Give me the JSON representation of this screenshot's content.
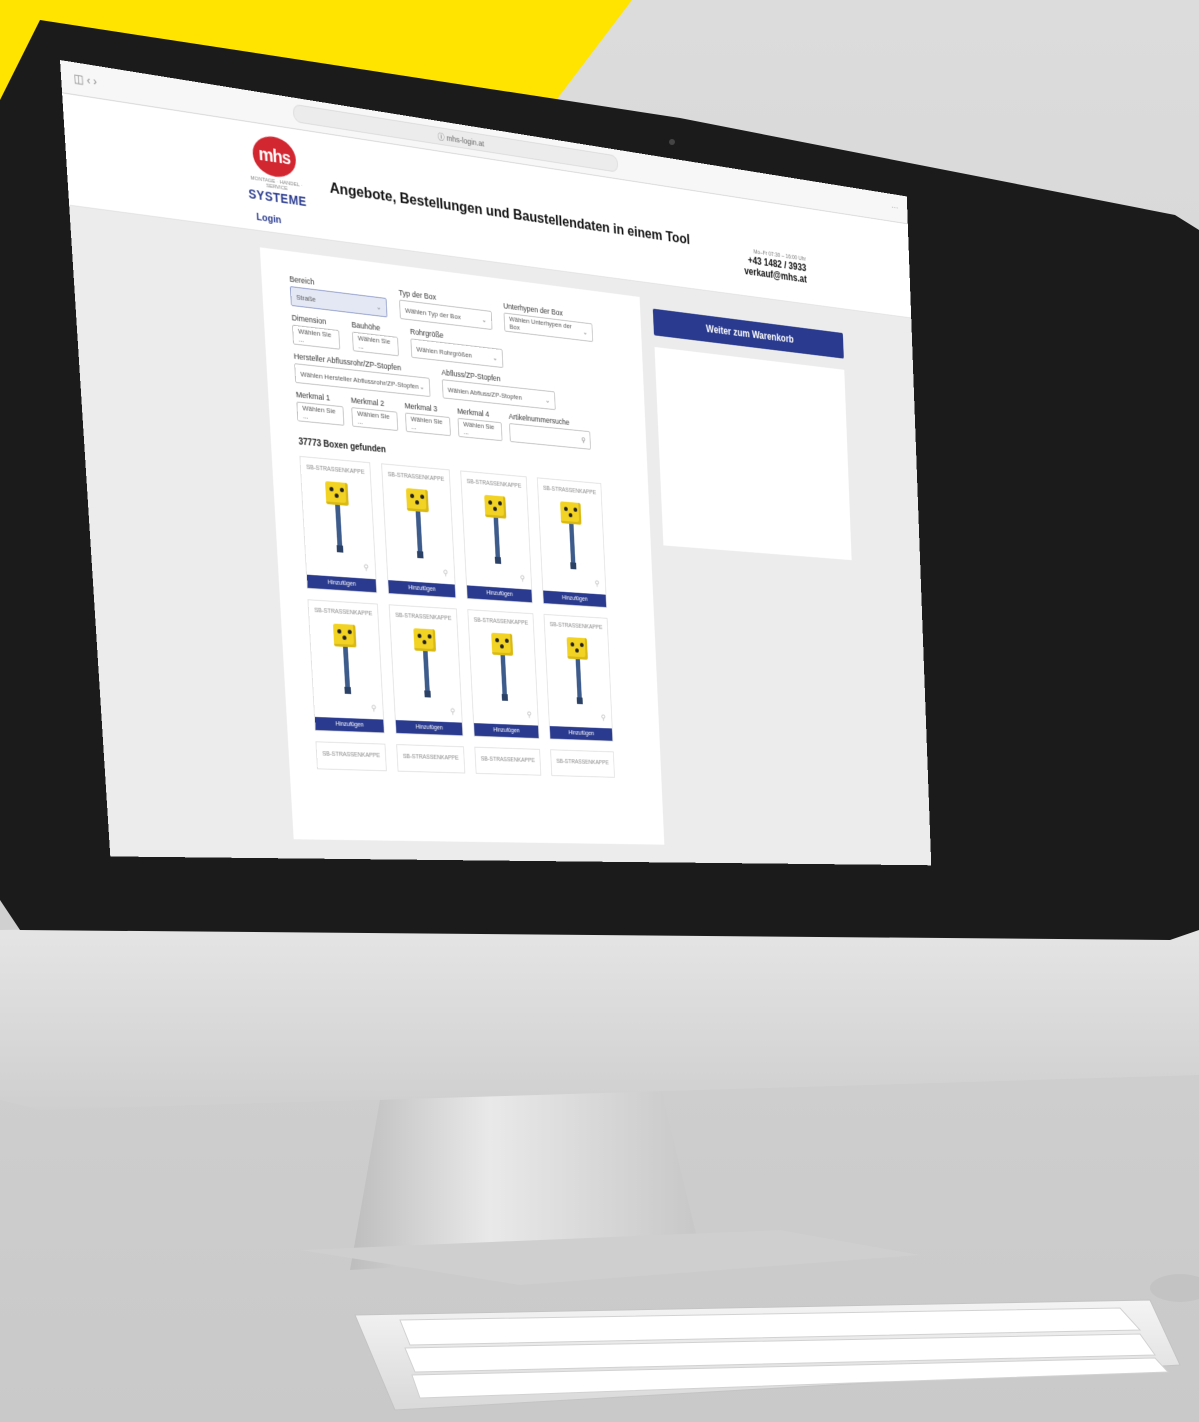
{
  "browser": {
    "url": "ⓘ mhs-login.at"
  },
  "header": {
    "logo": {
      "initials": "mhs",
      "initials_last": "s",
      "subtitle": "MONTAGE · HANDEL · SERVICE",
      "brand": "SYSTEME"
    },
    "tagline": "Angebote, Bestellungen und Baustellendaten in einem Tool",
    "login_label": "Login",
    "contact": {
      "hours_label": "Mo–Fr 07:30 – 16:00 Uhr",
      "phone": "+43 1482 / 3933",
      "email": "verkauf@mhs.at"
    }
  },
  "filters": {
    "row1": [
      {
        "label": "Bereich",
        "value": "Straße",
        "active": true
      },
      {
        "label": "Typ der Box",
        "value": "Wählen Typ der Box"
      },
      {
        "label": "Unterhypen der Box",
        "value": "Wählen Unterhypen der Box"
      }
    ],
    "row2": [
      {
        "label": "Dimension",
        "value": "Wählen Sie ..."
      },
      {
        "label": "Bauhöhe",
        "value": "Wählen Sie ..."
      },
      {
        "label": "Rohrgröße",
        "value": "Wählen Rohrgrößen"
      }
    ],
    "row3": [
      {
        "label": "Hersteller Abflussrohr/ZP-Stopfen",
        "value": "Wählen Hersteller Abflussrohr/ZP-Stopfen"
      },
      {
        "label": "Abfluss/ZP-Stopfen",
        "value": "Wählen Abfluss/ZP-Stopfen"
      }
    ],
    "row4": [
      {
        "label": "Merkmal 1",
        "value": "Wählen Sie ..."
      },
      {
        "label": "Merkmal 2",
        "value": "Wählen Sie ..."
      },
      {
        "label": "Merkmal 3",
        "value": "Wählen Sie ..."
      },
      {
        "label": "Merkmal 4",
        "value": "Wählen Sie ..."
      },
      {
        "label": "Artikelnummersuche",
        "value": ""
      }
    ]
  },
  "results": {
    "count_text": "37773 Boxen gefunden",
    "cards": [
      {
        "title": "SB-STRASSENKAPPE",
        "button": "Hinzufügen"
      },
      {
        "title": "SB-STRASSENKAPPE",
        "button": "Hinzufügen"
      },
      {
        "title": "SB-STRASSENKAPPE",
        "button": "Hinzufügen"
      },
      {
        "title": "SB-STRASSENKAPPE",
        "button": "Hinzufügen"
      },
      {
        "title": "SB-STRASSENKAPPE",
        "button": "Hinzufügen"
      },
      {
        "title": "SB-STRASSENKAPPE",
        "button": "Hinzufügen"
      },
      {
        "title": "SB-STRASSENKAPPE",
        "button": "Hinzufügen"
      },
      {
        "title": "SB-STRASSENKAPPE",
        "button": "Hinzufügen"
      }
    ],
    "more_cards": [
      {
        "title": "SB-STRASSENKAPPE"
      },
      {
        "title": "SB-STRASSENKAPPE"
      },
      {
        "title": "SB-STRASSENKAPPE"
      },
      {
        "title": "SB-STRASSENKAPPE"
      }
    ]
  },
  "cart": {
    "button_label": "Weiter zum Warenkorb"
  },
  "colors": {
    "accent": "#2a3b8f",
    "logo_red": "#d22630",
    "banner_yellow": "#ffe400"
  }
}
